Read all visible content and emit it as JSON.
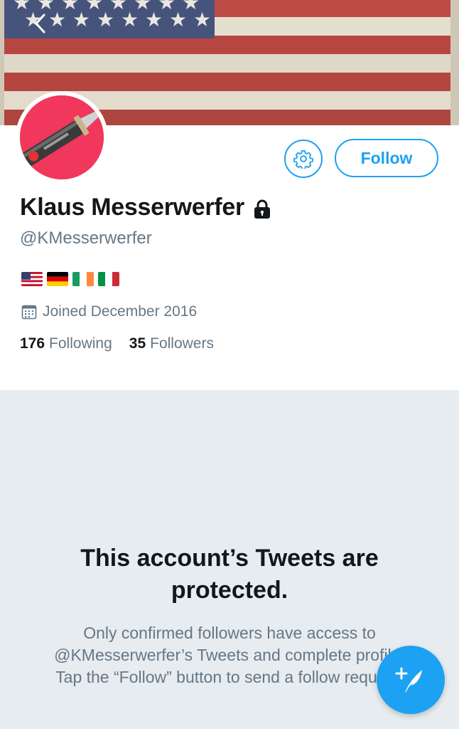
{
  "profile": {
    "name": "Klaus Messerwerfer",
    "handle": "@KMesserwerfer",
    "joined": "Joined December 2016",
    "following_count": "176",
    "following_label": "Following",
    "followers_count": "35",
    "followers_label": "Followers",
    "flags": [
      "🇺🇸",
      "🇩🇪",
      "🇮🇪",
      "🇮🇹"
    ]
  },
  "actions": {
    "follow_label": "Follow"
  },
  "protected": {
    "title": "This account’s Tweets are protected.",
    "body": "Only confirmed followers have access to @KMesserwerfer’s Tweets and complete profile. Tap the “Follow” button to send a follow request."
  },
  "icons": {
    "back": "chevron-left-icon",
    "settings": "gear-icon",
    "lock": "lock-icon",
    "calendar": "calendar-icon",
    "compose": "compose-tweet-icon"
  },
  "colors": {
    "accent": "#1da1f2",
    "secondary_text": "#657786",
    "page_background": "#e6ecf0",
    "avatar_background": "#f1375b"
  }
}
